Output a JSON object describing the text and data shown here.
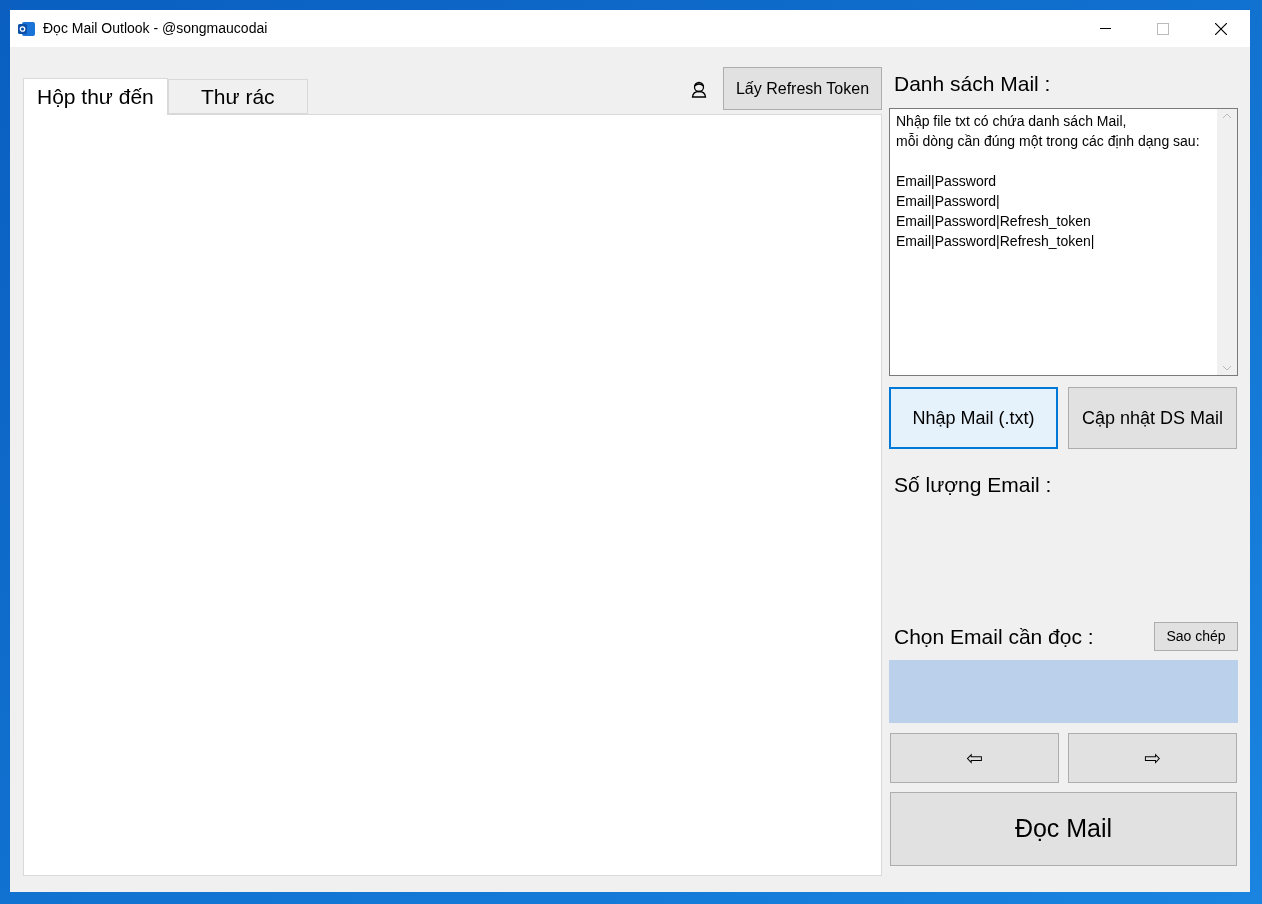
{
  "window": {
    "title": "Đọc Mail Outlook - @songmaucodai"
  },
  "tabs": [
    {
      "label": "Hộp thư đến",
      "selected": true
    },
    {
      "label": "Thư rác",
      "selected": false
    }
  ],
  "refresh_button": "Lấy Refresh Token",
  "mail_list": {
    "label": "Danh sách Mail :",
    "intro": [
      "Nhập file txt có chứa danh sách Mail,",
      "mỗi dòng cần đúng một trong các định dạng sau:"
    ],
    "formats": [
      "Email|Password",
      "Email|Password|",
      "Email|Password|Refresh_token",
      "Email|Password|Refresh_token|"
    ]
  },
  "import_buttons": [
    {
      "label": "Nhập Mail (.txt)",
      "focused": true
    },
    {
      "label": "Cập nhật DS Mail",
      "focused": false
    }
  ],
  "count_label": "Số lượng Email :",
  "choose_label": "Chọn Email cần đọc :",
  "copy_button": "Sao chép",
  "nav_buttons": [
    "⇦",
    "⇨"
  ],
  "read_button": "Đọc Mail"
}
